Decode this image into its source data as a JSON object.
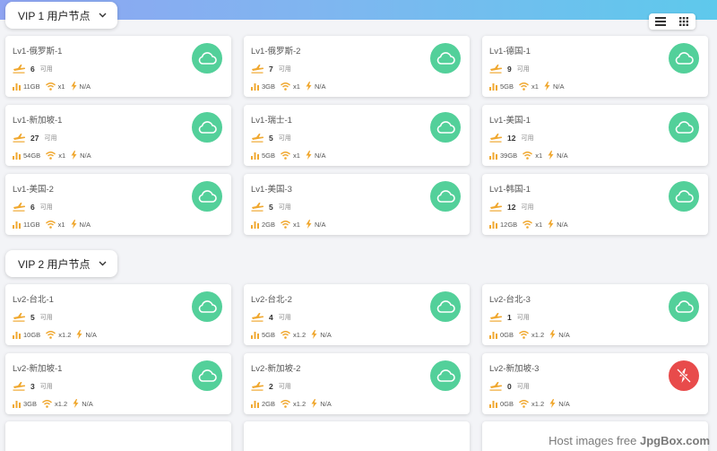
{
  "colors": {
    "online": "#53d09a",
    "offline": "#e84b4b",
    "accent": "#f0a830"
  },
  "sections": [
    {
      "title": "VIP 1 用户节点",
      "nodes": [
        {
          "name": "Lv1-俄罗斯-1",
          "count": "6",
          "status": "online",
          "traffic": "11GB",
          "ratio": "x1",
          "speed": "N/A"
        },
        {
          "name": "Lv1-俄罗斯-2",
          "count": "7",
          "status": "online",
          "traffic": "3GB",
          "ratio": "x1",
          "speed": "N/A"
        },
        {
          "name": "Lv1-德国-1",
          "count": "9",
          "status": "online",
          "traffic": "5GB",
          "ratio": "x1",
          "speed": "N/A"
        },
        {
          "name": "Lv1-新加坡-1",
          "count": "27",
          "status": "online",
          "traffic": "54GB",
          "ratio": "x1",
          "speed": "N/A"
        },
        {
          "name": "Lv1-瑞士-1",
          "count": "5",
          "status": "online",
          "traffic": "5GB",
          "ratio": "x1",
          "speed": "N/A"
        },
        {
          "name": "Lv1-美国-1",
          "count": "12",
          "status": "online",
          "traffic": "39GB",
          "ratio": "x1",
          "speed": "N/A"
        },
        {
          "name": "Lv1-美国-2",
          "count": "6",
          "status": "online",
          "traffic": "11GB",
          "ratio": "x1",
          "speed": "N/A"
        },
        {
          "name": "Lv1-美国-3",
          "count": "5",
          "status": "online",
          "traffic": "2GB",
          "ratio": "x1",
          "speed": "N/A"
        },
        {
          "name": "Lv1-韩国-1",
          "count": "12",
          "status": "online",
          "traffic": "12GB",
          "ratio": "x1",
          "speed": "N/A"
        }
      ]
    },
    {
      "title": "VIP 2 用户节点",
      "nodes": [
        {
          "name": "Lv2-台北-1",
          "count": "5",
          "status": "online",
          "traffic": "10GB",
          "ratio": "x1.2",
          "speed": "N/A"
        },
        {
          "name": "Lv2-台北-2",
          "count": "4",
          "status": "online",
          "traffic": "5GB",
          "ratio": "x1.2",
          "speed": "N/A"
        },
        {
          "name": "Lv2-台北-3",
          "count": "1",
          "status": "online",
          "traffic": "0GB",
          "ratio": "x1.2",
          "speed": "N/A"
        },
        {
          "name": "Lv2-新加坡-1",
          "count": "3",
          "status": "online",
          "traffic": "3GB",
          "ratio": "x1.2",
          "speed": "N/A"
        },
        {
          "name": "Lv2-新加坡-2",
          "count": "2",
          "status": "online",
          "traffic": "2GB",
          "ratio": "x1.2",
          "speed": "N/A"
        },
        {
          "name": "Lv2-新加坡-3",
          "count": "0",
          "status": "offline",
          "traffic": "0GB",
          "ratio": "x1.2",
          "speed": "N/A"
        }
      ]
    }
  ],
  "available_label": "可用",
  "watermark": {
    "prefix": "Host images free ",
    "brand": "JpgBox.com"
  }
}
